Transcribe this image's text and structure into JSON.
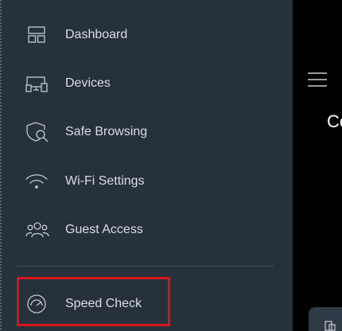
{
  "drawer": {
    "items": [
      {
        "label": "Dashboard",
        "icon": "dashboard-icon"
      },
      {
        "label": "Devices",
        "icon": "devices-icon"
      },
      {
        "label": "Safe Browsing",
        "icon": "shield-search-icon"
      },
      {
        "label": "Wi-Fi Settings",
        "icon": "wifi-icon"
      },
      {
        "label": "Guest Access",
        "icon": "guest-access-icon"
      },
      {
        "label": "Speed Check",
        "icon": "speedometer-icon",
        "highlighted": true
      }
    ]
  },
  "background": {
    "partial_title": "Co",
    "menu_icon": "hamburger-menu-icon",
    "card_icon": "device-card-icon"
  },
  "colors": {
    "drawer_bg": "#27313c",
    "text": "#d9dee4",
    "highlight_border": "#d9151b",
    "background": "#000000"
  }
}
